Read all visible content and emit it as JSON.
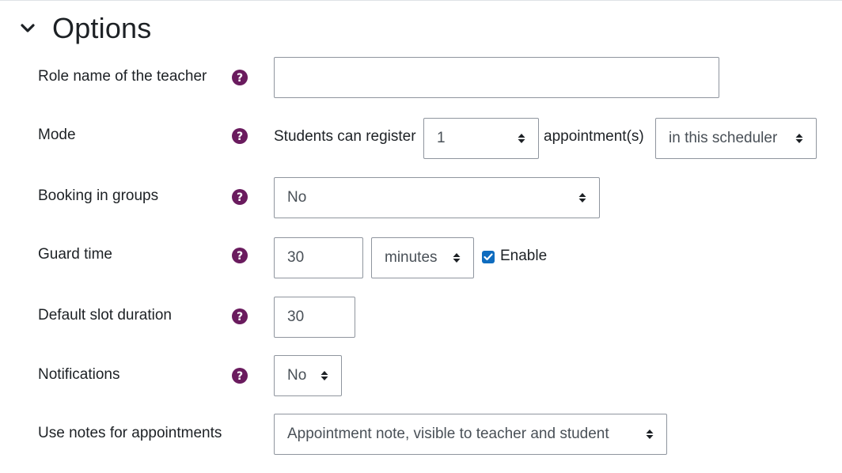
{
  "section": {
    "title": "Options"
  },
  "fields": {
    "teacher_role": {
      "label": "Role name of the teacher",
      "value": ""
    },
    "mode": {
      "label": "Mode",
      "prefix": "Students can register",
      "count_value": "1",
      "middle": "appointment(s)",
      "scope_value": "in this scheduler"
    },
    "booking_groups": {
      "label": "Booking in groups",
      "value": "No"
    },
    "guard_time": {
      "label": "Guard time",
      "value": "30",
      "unit_value": "minutes",
      "enable_label": "Enable",
      "enabled": true
    },
    "slot_duration": {
      "label": "Default slot duration",
      "value": "30"
    },
    "notifications": {
      "label": "Notifications",
      "value": "No"
    },
    "notes": {
      "label": "Use notes for appointments",
      "value": "Appointment note, visible to teacher and student"
    }
  },
  "colors": {
    "help_icon": "#6a1b5e",
    "checkbox": "#0f6cbf",
    "border": "#8f959e"
  }
}
